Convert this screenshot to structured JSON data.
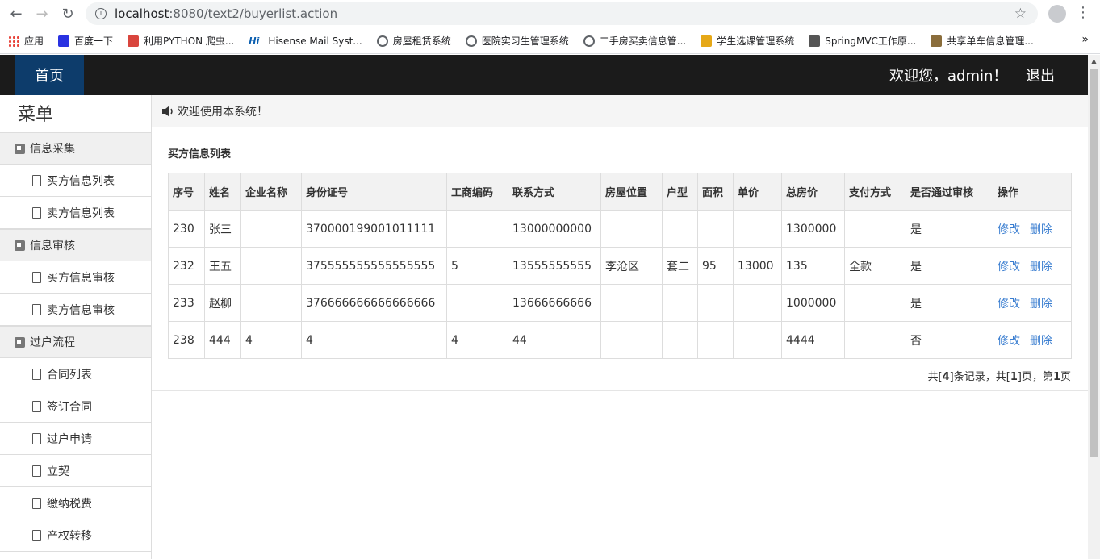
{
  "browser": {
    "url_host": "localhost",
    "url_path": ":8080/text2/buyerlist.action",
    "bookmarks": [
      {
        "label": "应用",
        "icon": "apps-grid-icon",
        "color": "#e8453c"
      },
      {
        "label": "百度一下",
        "icon": "baidu-paw-icon",
        "color": "#2932e1"
      },
      {
        "label": "利用PYTHON 爬虫...",
        "icon": "jian-icon",
        "color": "#d9453d"
      },
      {
        "label": "Hisense Mail Syst...",
        "icon": "hisense-icon",
        "color": "#0b5fb0"
      },
      {
        "label": "房屋租赁系统",
        "icon": "globe-icon",
        "color": "#5f6368"
      },
      {
        "label": "医院实习生管理系统",
        "icon": "globe-icon",
        "color": "#5f6368"
      },
      {
        "label": "二手房买卖信息管...",
        "icon": "globe-icon",
        "color": "#5f6368"
      },
      {
        "label": "学生选课管理系统",
        "icon": "folder-flag-icon",
        "color": "#e6a817"
      },
      {
        "label": "SpringMVC工作原...",
        "icon": "springmvc-icon",
        "color": "#555555"
      },
      {
        "label": "共享单车信息管理...",
        "icon": "image-icon",
        "color": "#8a6d3b"
      }
    ],
    "more": "»"
  },
  "header": {
    "home": "首页",
    "welcome": "欢迎您，admin！",
    "logout": "退出",
    "bg_color": "#1b1b1b",
    "home_color": "#0d3c6b"
  },
  "sidebar": {
    "title": "菜单",
    "groups": [
      {
        "label": "信息采集",
        "items": [
          "买方信息列表",
          "卖方信息列表"
        ]
      },
      {
        "label": "信息审核",
        "items": [
          "买方信息审核",
          "卖方信息审核"
        ]
      },
      {
        "label": "过户流程",
        "items": [
          "合同列表",
          "签订合同",
          "过户申请",
          "立契",
          "缴纳税费",
          "产权转移"
        ]
      }
    ]
  },
  "main": {
    "notice": "欢迎使用本系统！",
    "section_title": "买方信息列表",
    "columns": [
      "序号",
      "姓名",
      "企业名称",
      "身份证号",
      "工商编码",
      "联系方式",
      "房屋位置",
      "户型",
      "面积",
      "单价",
      "总房价",
      "支付方式",
      "是否通过审核",
      "操作"
    ],
    "rows": [
      [
        "230",
        "张三",
        "",
        "370000199001011111",
        "",
        "13000000000",
        "",
        "",
        "",
        "",
        "1300000",
        "",
        "是"
      ],
      [
        "232",
        "王五",
        "",
        "375555555555555555",
        "5",
        "13555555555",
        "李沧区",
        "套二",
        "95",
        "13000",
        "135",
        "全款",
        "是"
      ],
      [
        "233",
        "赵柳",
        "",
        "376666666666666666",
        "",
        "13666666666",
        "",
        "",
        "",
        "",
        "1000000",
        "",
        "是"
      ],
      [
        "238",
        "444",
        "4",
        "4",
        "4",
        "44",
        "",
        "",
        "",
        "",
        "4444",
        "",
        "否"
      ]
    ],
    "edit_label": "修改",
    "delete_label": "删除",
    "link_color": "#3c7fd1",
    "pager": {
      "prefix": "共[",
      "total": "4",
      "mid1": "]条记录，共[",
      "pages": "1",
      "mid2": "]页，第",
      "current": "1",
      "suffix": "页"
    }
  }
}
